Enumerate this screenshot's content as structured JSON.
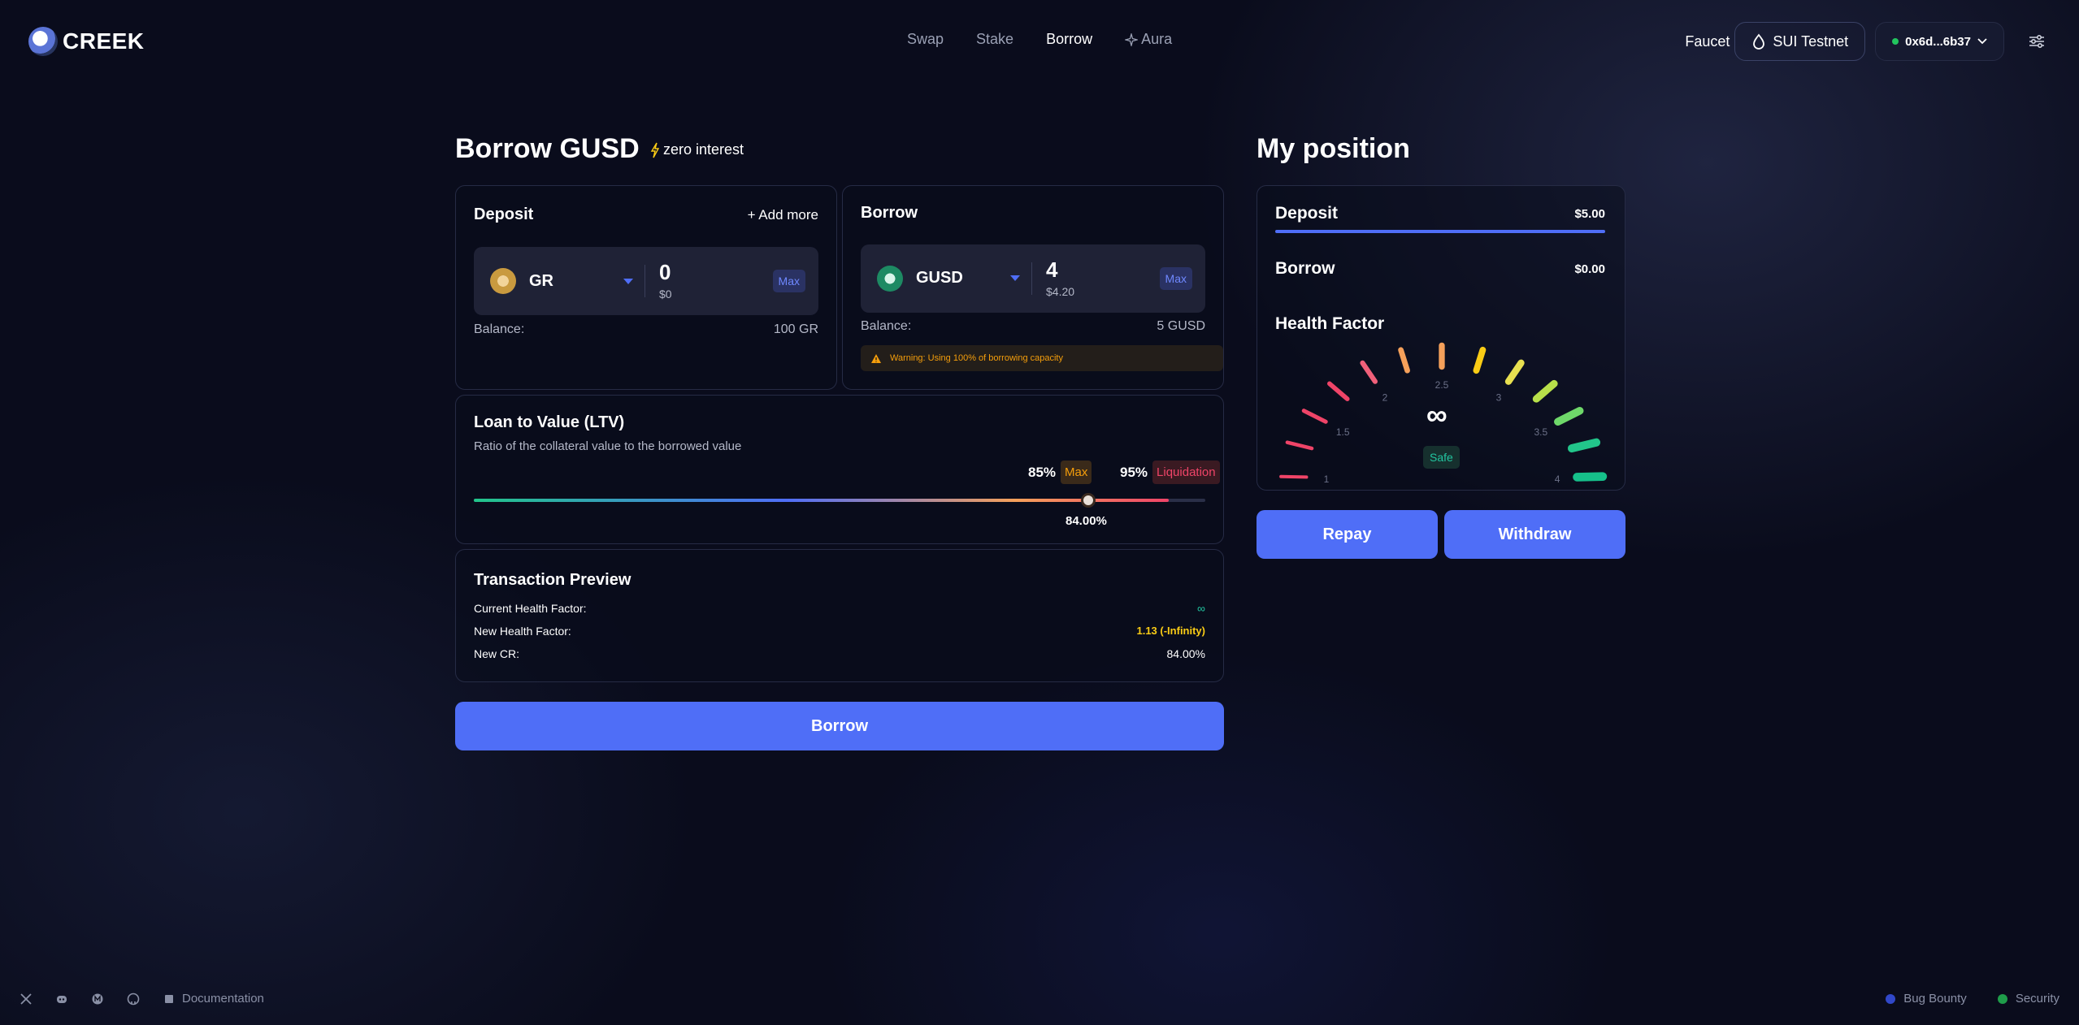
{
  "header": {
    "brand": "CREEK",
    "nav": [
      "Swap",
      "Stake",
      "Borrow",
      "Aura"
    ],
    "active_nav": "Borrow",
    "faucet": "Faucet",
    "network": "SUI Testnet",
    "wallet": "0x6d...6b37"
  },
  "borrow_panel": {
    "title": "Borrow GUSD",
    "badge": "zero interest",
    "deposit": {
      "title": "Deposit",
      "add_more": "+ Add more",
      "token": "GR",
      "amount": "0",
      "amount_usd": "$0",
      "max": "Max",
      "balance_label": "Balance:",
      "balance_value": "100 GR"
    },
    "borrow": {
      "title": "Borrow",
      "token": "GUSD",
      "amount": "4",
      "amount_usd": "$4.20",
      "max": "Max",
      "balance_label": "Balance:",
      "balance_value": "5 GUSD",
      "warning": "Warning: Using 100% of borrowing capacity"
    },
    "ltv": {
      "title": "Loan to Value (LTV)",
      "subtitle": "Ratio of the collateral value to the borrowed value",
      "max_pct": "85%",
      "max_label": "Max",
      "liq_pct": "95%",
      "liq_label": "Liquidation",
      "value_label": "84.00%",
      "value": 84
    },
    "preview": {
      "title": "Transaction Preview",
      "rows": [
        {
          "label": "Current Health Factor:",
          "value": "∞"
        },
        {
          "label": "New Health Factor:",
          "value": "1.13 (-Infinity)"
        },
        {
          "label": "New CR:",
          "value": "84.00%"
        }
      ]
    },
    "submit": "Borrow"
  },
  "position": {
    "title": "My position",
    "deposit_label": "Deposit",
    "deposit_value": "$5.00",
    "borrow_label": "Borrow",
    "borrow_value": "$0.00",
    "health_title": "Health Factor",
    "health_value": "∞",
    "health_status": "Safe",
    "gauge_ticks": [
      "1",
      "1.5",
      "2",
      "2.5",
      "3",
      "3.5",
      "4"
    ],
    "repay": "Repay",
    "withdraw": "Withdraw"
  },
  "footer": {
    "documentation": "Documentation",
    "bug_bounty": "Bug Bounty",
    "security": "Security"
  },
  "colors": {
    "accent": "#4f6ef7",
    "safe": "#22c5a0",
    "warning": "#f59e0b",
    "danger": "#ef4468"
  }
}
